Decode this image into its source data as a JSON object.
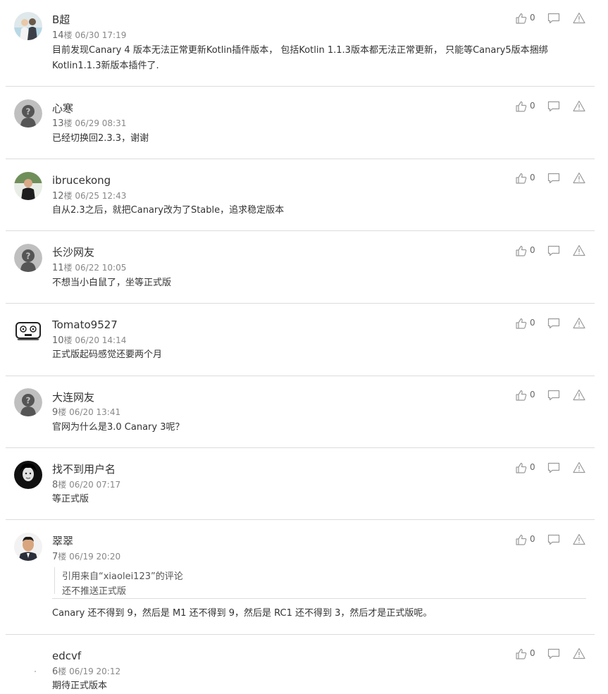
{
  "icons": {
    "like": "thumbs-up-icon",
    "reply": "speech-bubble-icon",
    "report": "warning-triangle-icon"
  },
  "colors": {
    "text": "#333333",
    "meta": "#888888",
    "divider": "#dcdcdc",
    "icon": "#9a9a9a"
  },
  "comments": [
    {
      "username": "B超",
      "floor_num": "14",
      "floor_suffix": "楼",
      "time": "06/30 17:19",
      "text": "目前发现Canary 4 版本无法正常更新Kotlin插件版本， 包括Kotlin 1.1.3版本都无法正常更新， 只能等Canary5版本捆绑Kotlin1.1.3新版本插件了.",
      "likes": "0"
    },
    {
      "username": "心寒",
      "floor_num": "13",
      "floor_suffix": "楼",
      "time": "06/29 08:31",
      "text": "已经切换回2.3.3，谢谢",
      "likes": "0"
    },
    {
      "username": "ibrucekong",
      "floor_num": "12",
      "floor_suffix": "楼",
      "time": "06/25 12:43",
      "text": "自从2.3之后，就把Canary改为了Stable，追求稳定版本",
      "likes": "0"
    },
    {
      "username": "长沙网友",
      "floor_num": "11",
      "floor_suffix": "楼",
      "time": "06/22 10:05",
      "text": "不想当小白鼠了，坐等正式版",
      "likes": "0"
    },
    {
      "username": "Tomato9527",
      "floor_num": "10",
      "floor_suffix": "楼",
      "time": "06/20 14:14",
      "text": "正式版起码感觉还要两个月",
      "likes": "0"
    },
    {
      "username": "大连网友",
      "floor_num": "9",
      "floor_suffix": "楼",
      "time": "06/20 13:41",
      "text": "官网为什么是3.0 Canary 3呢？",
      "likes": "0"
    },
    {
      "username": "找不到用户名",
      "floor_num": "8",
      "floor_suffix": "楼",
      "time": "06/20 07:17",
      "text": "等正式版",
      "likes": "0"
    },
    {
      "username": "翠翠",
      "floor_num": "7",
      "floor_suffix": "楼",
      "time": "06/19 20:20",
      "quote_source": "引用来自“xiaolei123”的评论",
      "quote_text": "还不推送正式版",
      "text": "Canary 还不得到 9，然后是 M1 还不得到 9，然后是 RC1 还不得到 3，然后才是正式版呢。",
      "likes": "0"
    },
    {
      "username": "edcvf",
      "floor_num": "6",
      "floor_suffix": "楼",
      "time": "06/19 20:12",
      "text": "期待正式版本",
      "likes": "0"
    }
  ]
}
